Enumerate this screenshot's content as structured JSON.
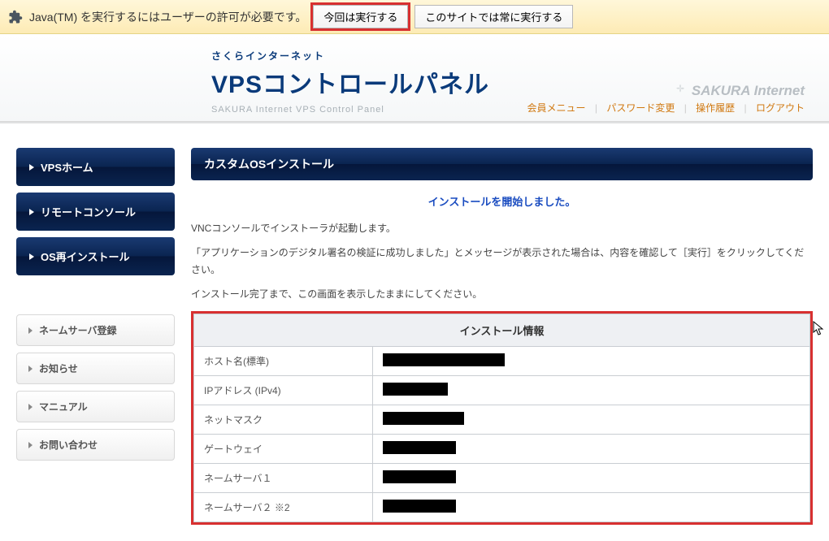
{
  "notification": {
    "message": "Java(TM) を実行するにはユーザーの許可が必要です。",
    "btn_run_once": "今回は実行する",
    "btn_run_always": "このサイトでは常に実行する"
  },
  "header": {
    "brand_small": "さくらインターネット",
    "brand_big": "VPSコントロールパネル",
    "brand_sub": "SAKURA Internet VPS Control Panel",
    "right_logo": "SAKURA Internet"
  },
  "topnav": {
    "member_menu": "会員メニュー",
    "password_change": "パスワード変更",
    "history": "操作履歴",
    "logout": "ログアウト"
  },
  "sidebar": {
    "primary": [
      {
        "label": "VPSホーム"
      },
      {
        "label": "リモートコンソール"
      },
      {
        "label": "OS再インストール"
      }
    ],
    "secondary": [
      {
        "label": "ネームサーバ登録"
      },
      {
        "label": "お知らせ"
      },
      {
        "label": "マニュアル"
      },
      {
        "label": "お問い合わせ"
      }
    ]
  },
  "content": {
    "title": "カスタムOSインストール",
    "status": "インストールを開始しました。",
    "desc1": "VNCコンソールでインストーラが起動します。",
    "desc2": "「アプリケーションのデジタル署名の検証に成功しました」とメッセージが表示された場合は、内容を確認して［実行］をクリックしてください。",
    "desc3": "インストール完了まで、この画面を表示したままにしてください。",
    "info_header": "インストール情報",
    "rows": [
      {
        "label": "ホスト名(標準)",
        "width": 150
      },
      {
        "label": "IPアドレス (IPv4)",
        "width": 80
      },
      {
        "label": "ネットマスク",
        "width": 100
      },
      {
        "label": "ゲートウェイ",
        "width": 90
      },
      {
        "label": "ネームサーバ１",
        "width": 90
      },
      {
        "label": "ネームサーバ２ ※2",
        "width": 90
      }
    ]
  }
}
